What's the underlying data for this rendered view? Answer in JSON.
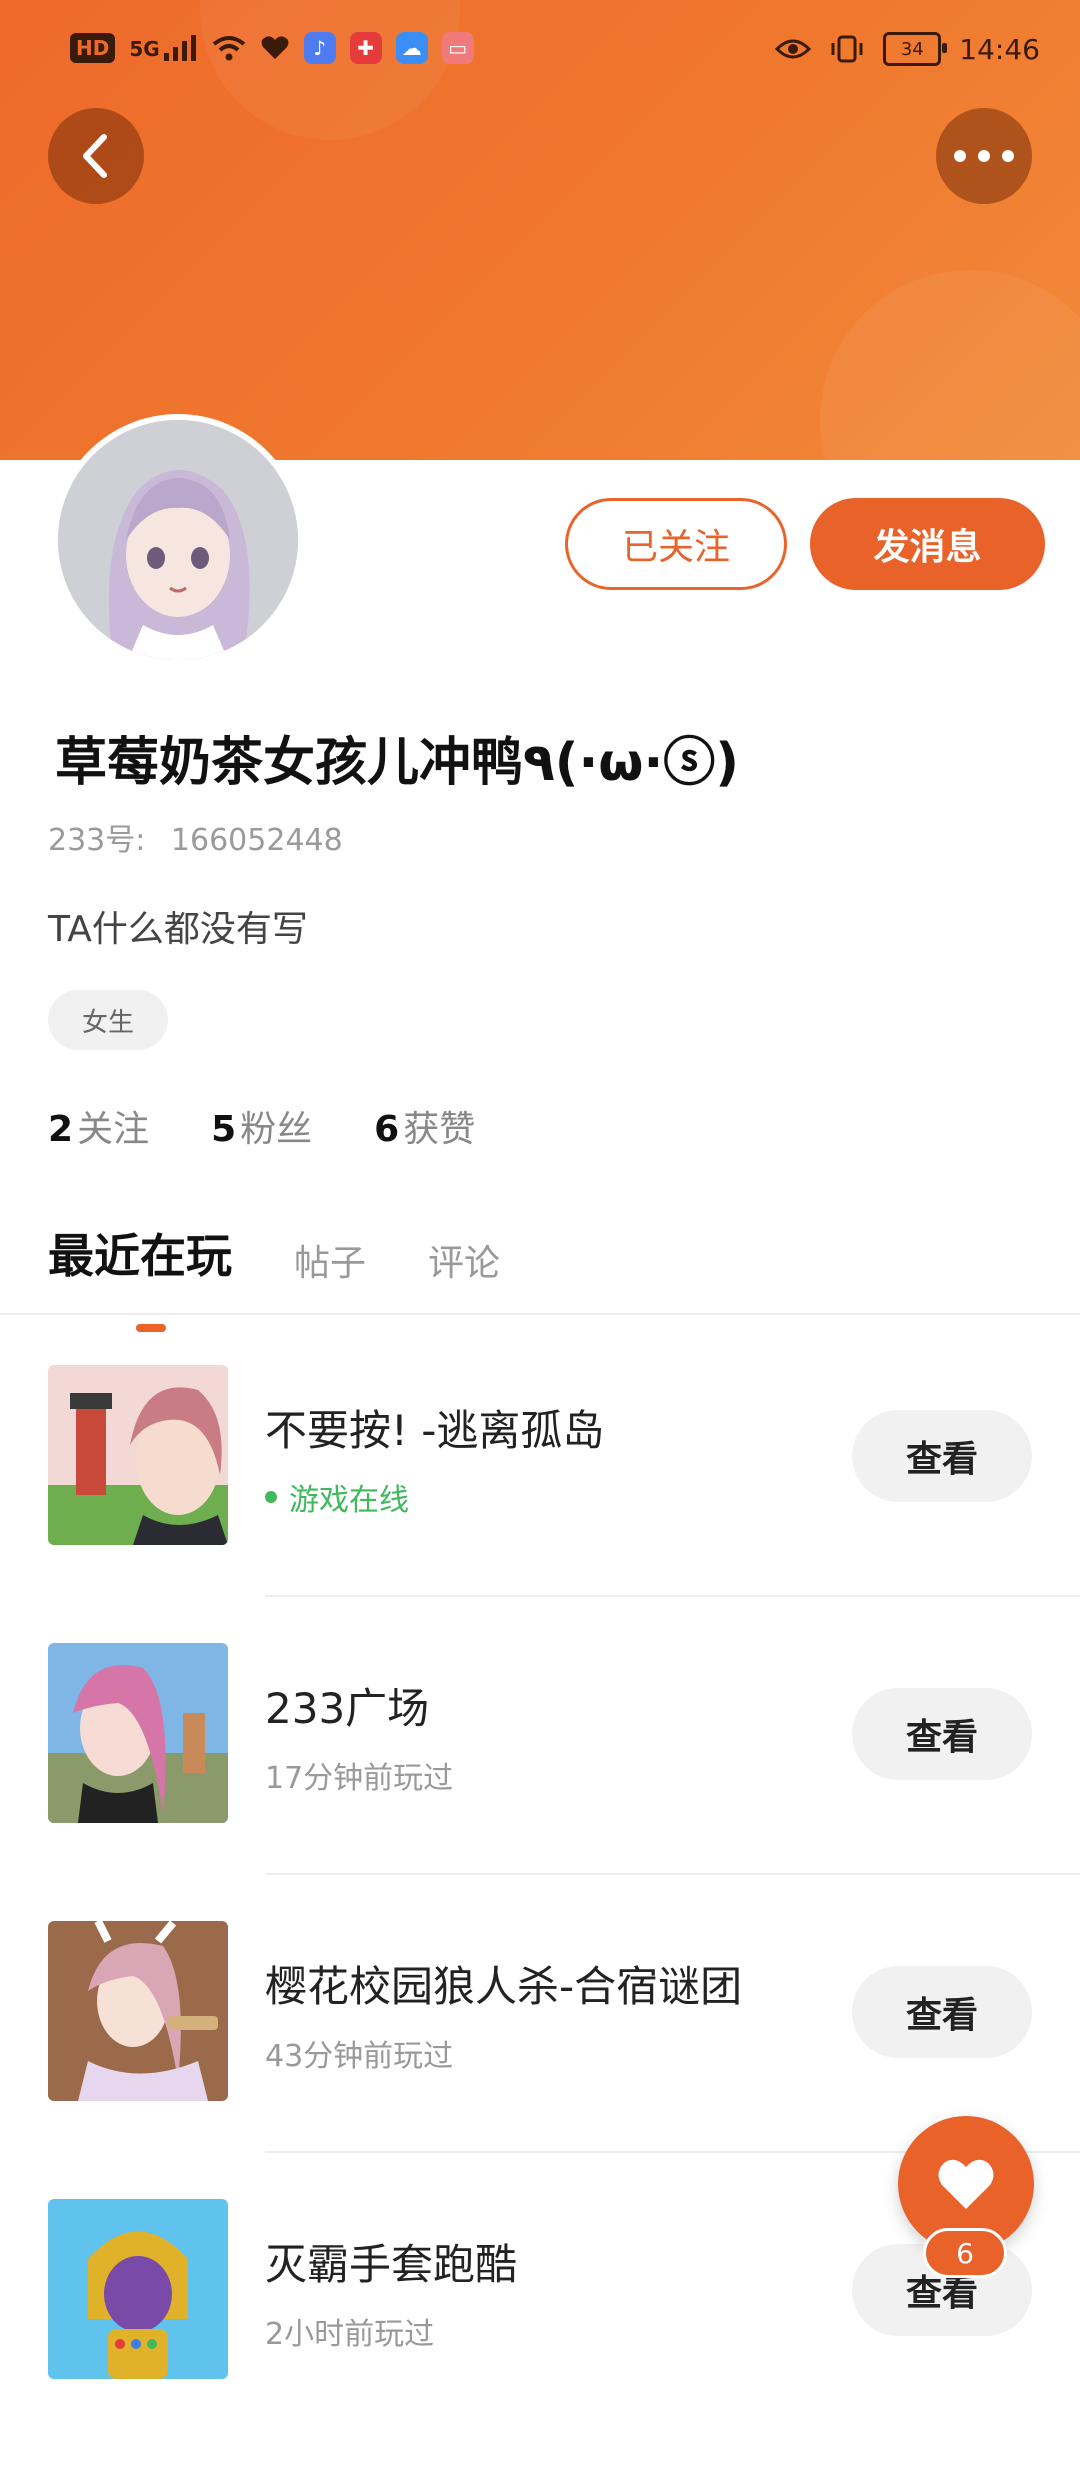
{
  "status_bar": {
    "network_hd": "HD",
    "network_5g": "5G",
    "battery": "34",
    "time": "14:46"
  },
  "profile": {
    "follow_label": "已关注",
    "message_label": "发消息",
    "username": "草莓奶茶女孩儿冲鸭٩(·ω·ⓢ)",
    "uid_label": "233号:",
    "uid_value": "166052448",
    "bio": "TA什么都没有写",
    "gender": "女生",
    "stats": {
      "following_count": "2",
      "following_label": "关注",
      "fans_count": "5",
      "fans_label": "粉丝",
      "likes_count": "6",
      "likes_label": "获赞"
    }
  },
  "tabs": [
    {
      "label": "最近在玩"
    },
    {
      "label": "帖子"
    },
    {
      "label": "评论"
    }
  ],
  "games": [
    {
      "title": "不要按! -逃离孤岛",
      "status": "游戏在线",
      "view_label": "查看"
    },
    {
      "title": "233广场",
      "status": "17分钟前玩过",
      "view_label": "查看"
    },
    {
      "title": "樱花校园狼人杀-合宿谜团",
      "status": "43分钟前玩过",
      "view_label": "查看"
    },
    {
      "title": "灭霸手套跑酷",
      "status": "2小时前玩过",
      "view_label": "查看"
    }
  ],
  "like_fab": {
    "count": "6"
  },
  "colors": {
    "accent": "#e8622a",
    "online": "#3fb95c"
  }
}
